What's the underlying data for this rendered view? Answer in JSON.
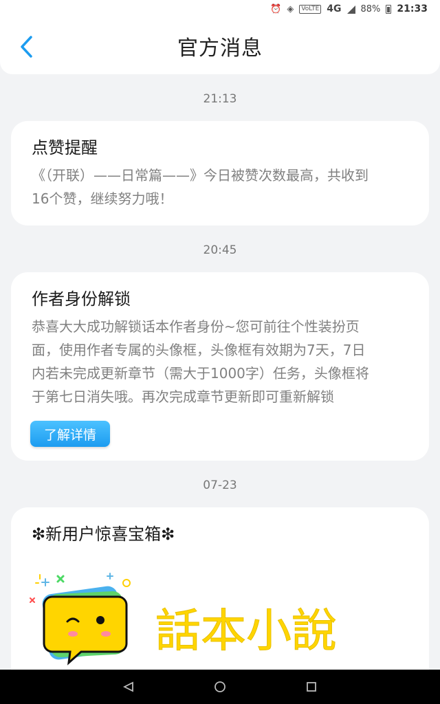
{
  "status_bar": {
    "volte": "VoLTE",
    "network": "4G",
    "battery": "88%",
    "time": "21:33"
  },
  "header": {
    "title": "官方消息"
  },
  "messages": [
    {
      "time": "21:13",
      "title": "点赞提醒",
      "body_lines": [
        "《（开联）——日常篇——》今日被赞次数最高，共收到",
        "16个赞，继续努力哦！"
      ]
    },
    {
      "time": "20:45",
      "title": "作者身份解锁",
      "body_lines": [
        "恭喜大大成功解锁话本作者身份~您可前往个性装扮页",
        "面，使用作者专属的头像框，头像框有效期为7天，7日",
        "内若未完成更新章节（需大于1000字）任务，头像框将",
        "于第七日消失哦。再次完成章节更新即可重新解锁"
      ],
      "button": "了解详情"
    },
    {
      "time": "07-23",
      "title": "❇新用户惊喜宝箱❇",
      "logo_text": "話本小說"
    }
  ],
  "colors": {
    "accent": "#1c9cf0",
    "logo_yellow": "#ffd500",
    "background": "#f2f3f5"
  },
  "icons": {
    "back": "chevron-left-icon",
    "nav_back": "triangle-back-icon",
    "nav_home": "circle-home-icon",
    "nav_recent": "square-recent-icon"
  }
}
